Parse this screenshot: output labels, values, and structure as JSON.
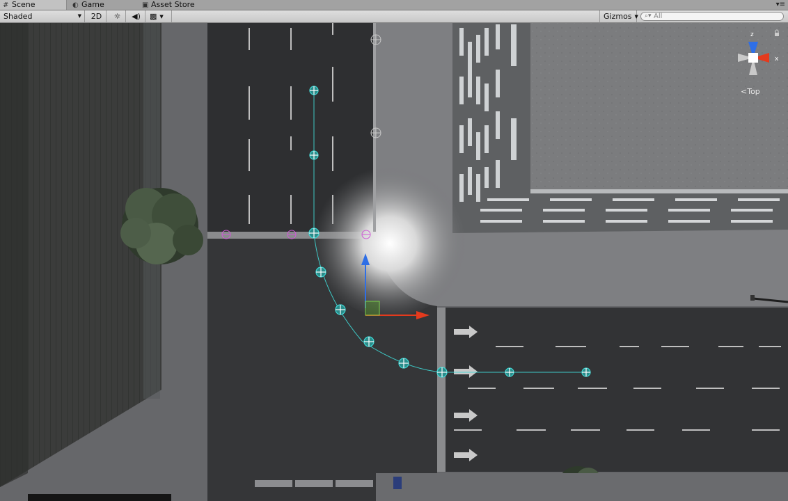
{
  "tabs": [
    {
      "label": "Scene",
      "icon": "grid-icon",
      "active": true
    },
    {
      "label": "Game",
      "icon": "pacman-icon",
      "active": false
    },
    {
      "label": "Asset Store",
      "icon": "bag-icon",
      "active": false
    }
  ],
  "toolbar": {
    "draw_mode": "Shaded",
    "mode_2d": "2D",
    "gizmos": "Gizmos",
    "search_placeholder": "All"
  },
  "orientation_gizmo": {
    "axis_z": "z",
    "axis_x": "x",
    "view_label": "Top"
  },
  "colors": {
    "waypoint": "#3fd9d6",
    "waypoint_secondary": "#cf5ad6",
    "axis_y": "#2f6fe6",
    "axis_x": "#e43a1d",
    "handle_plane": "#4d8a2a"
  }
}
